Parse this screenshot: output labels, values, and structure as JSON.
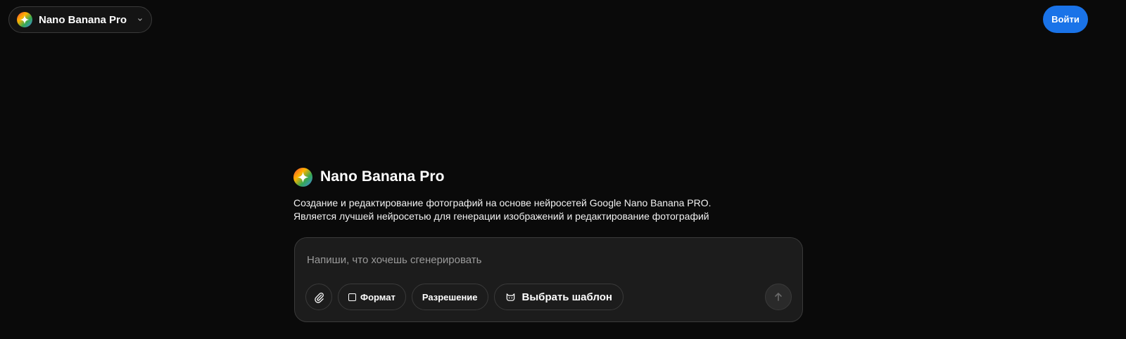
{
  "header": {
    "model_selector": {
      "label": "Nano Banana Pro",
      "logo_icon": "sparkle-gradient-icon",
      "chevron_icon": "chevron-down-icon"
    },
    "login_label": "Войти"
  },
  "hero": {
    "title": "Nano Banana Pro",
    "description_line1": "Создание и редактирование фотографий на основе нейросетей Google Nano Banana PRO.",
    "description_line2": "Является лучшей нейросетью для генерации изображений и редактирование фотографий"
  },
  "prompt": {
    "value": "",
    "placeholder": "Напиши, что хочешь сгенерировать",
    "toolbar": {
      "attach_icon": "paperclip-icon",
      "format_label": "Формат",
      "resolution_label": "Разрешение",
      "template_label": "Выбрать шаблон",
      "template_icon": "cat-icon",
      "send_icon": "arrow-up-icon"
    }
  },
  "colors": {
    "background": "#0a0a0a",
    "accent": "#1a73e8",
    "panel": "#1c1c1c",
    "border": "#3a3a3a"
  }
}
